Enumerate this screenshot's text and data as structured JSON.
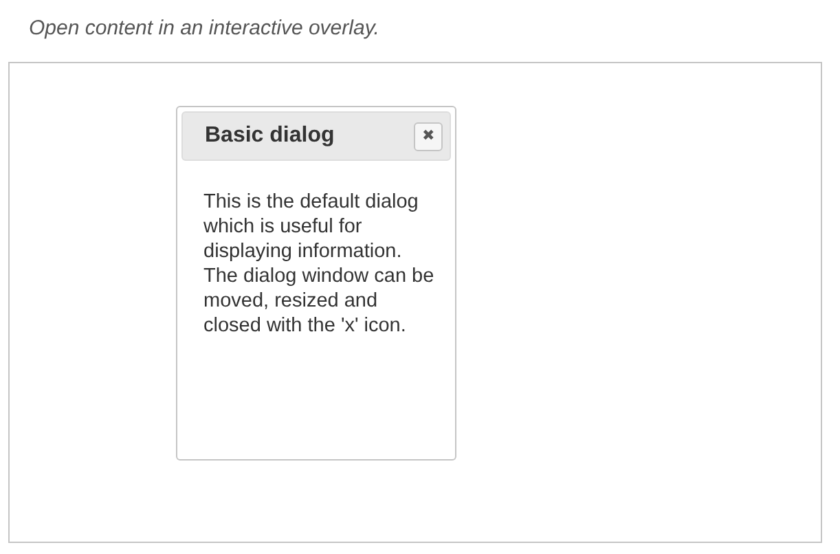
{
  "description": "Open content in an interactive overlay.",
  "dialog": {
    "title": "Basic dialog",
    "close_label": "✖",
    "body": "This is the default dialog which is useful for displaying information. The dialog window can be moved, resized and closed with the 'x' icon."
  }
}
